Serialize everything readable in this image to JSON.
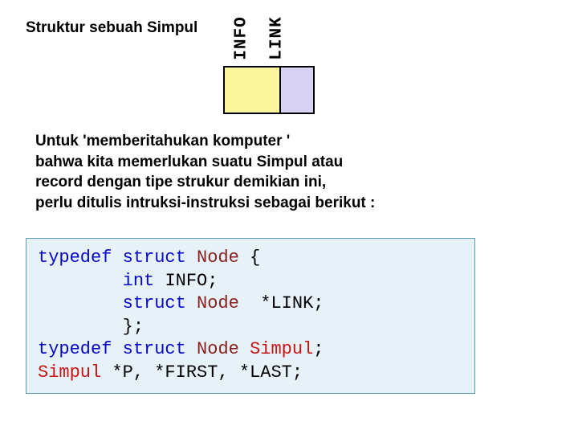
{
  "title": "Struktur sebuah Simpul",
  "diagram": {
    "label_info": "INFO",
    "label_link": "LINK"
  },
  "description": {
    "l1": "Untuk 'memberitahukan komputer '",
    "l2": "bahwa kita memerlukan suatu Simpul atau",
    "l3": "record dengan tipe strukur demikian ini,",
    "l4": "perlu ditulis intruksi-instruksi sebagai berikut :"
  },
  "code": {
    "kw_typedef": "typedef",
    "kw_struct": "struct",
    "kw_int": "int",
    "t_node": "Node",
    "field_info": "INFO;",
    "ptr_link": "*LINK;",
    "brace_open": "{",
    "brace_close": "};",
    "id_simpul": "Simpul",
    "semi": ";",
    "decl_ptrs": "*P, *FIRST, *LAST;"
  }
}
